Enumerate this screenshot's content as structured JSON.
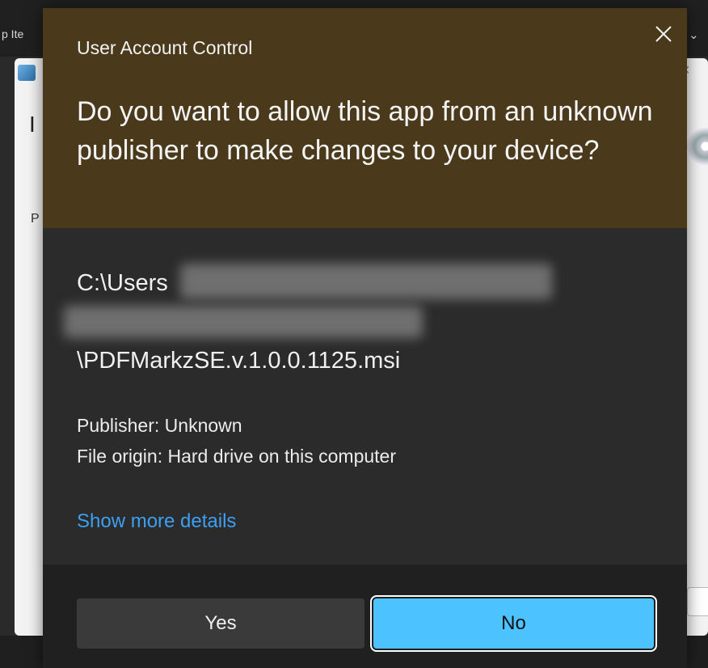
{
  "background": {
    "title_fragment": "p Ite",
    "letter_i": "I",
    "letter_p": "P"
  },
  "dialog": {
    "title": "User Account Control",
    "question": "Do you want to allow this app from an unknown publisher to make changes to your device?",
    "path_prefix": "C:\\Users",
    "path_file": "\\PDFMarkzSE.v.1.0.0.1125.msi",
    "publisher": "Publisher: Unknown",
    "file_origin": "File origin: Hard drive on this computer",
    "more_details": "Show more details",
    "yes_label": "Yes",
    "no_label": "No"
  },
  "colors": {
    "header": "#4a3a1b",
    "body": "#2b2b2b",
    "footer": "#202020",
    "accent": "#4cc2ff",
    "link": "#3d9ff2"
  }
}
